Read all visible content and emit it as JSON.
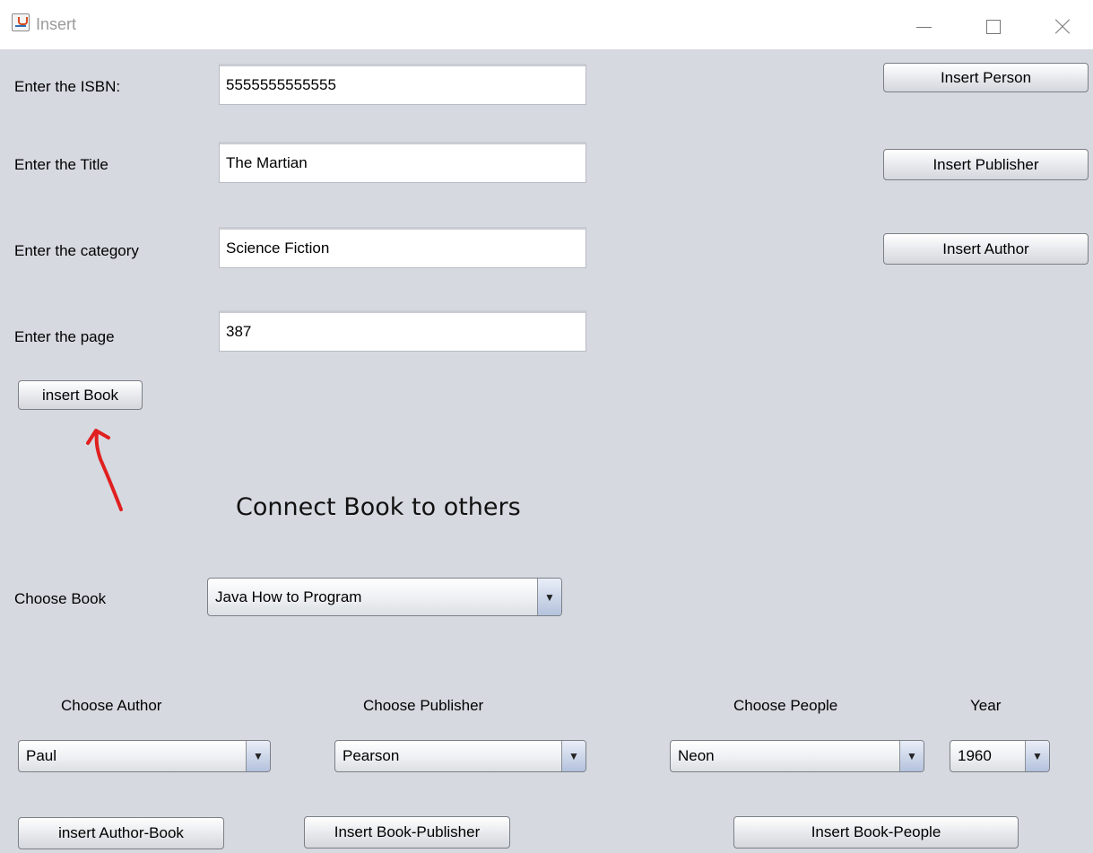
{
  "window": {
    "title": "Insert",
    "icon": "java-icon"
  },
  "book_form": {
    "isbn_label": "Enter the ISBN:",
    "isbn_value": "5555555555555",
    "title_label": "Enter the Title",
    "title_value": "The Martian",
    "category_label": "Enter the category",
    "category_value": "Science Fiction",
    "page_label": "Enter the page",
    "page_value": "387",
    "insert_book_label": "insert Book"
  },
  "side_buttons": {
    "insert_person": "Insert Person",
    "insert_publisher": "Insert Publisher",
    "insert_author": "Insert Author"
  },
  "connect": {
    "heading": "Connect Book to others",
    "choose_book_label": "Choose Book",
    "book_selected": "Java How to Program",
    "author_label": "Choose Author",
    "author_selected": "Paul",
    "publisher_label": "Choose Publisher",
    "publisher_selected": "Pearson",
    "people_label": "Choose People",
    "people_selected": "Neon",
    "year_label": "Year",
    "year_selected": "1960",
    "insert_author_book": "insert Author-Book",
    "insert_book_publisher": "Insert Book-Publisher",
    "insert_book_people": "Insert Book-People"
  },
  "colors": {
    "background": "#d6d9e0",
    "annotation_arrow": "#e02020"
  }
}
